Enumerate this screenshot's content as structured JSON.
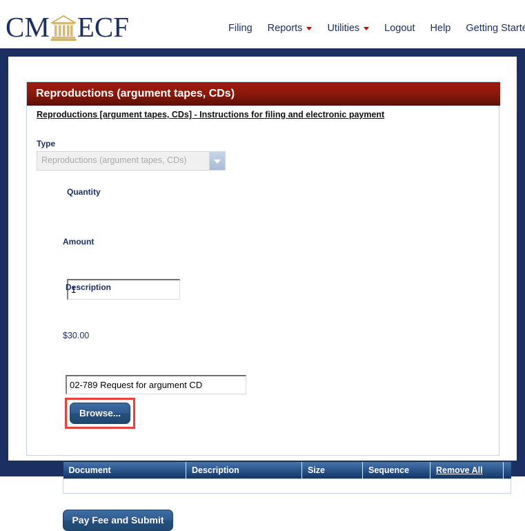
{
  "header": {
    "logo": {
      "left_text": "CM",
      "right_text": "ECF",
      "icon": "courthouse-icon"
    },
    "nav": [
      {
        "label": "Filing",
        "has_dropdown": false
      },
      {
        "label": "Reports",
        "has_dropdown": true
      },
      {
        "label": "Utilities",
        "has_dropdown": true
      },
      {
        "label": "Logout",
        "has_dropdown": false
      },
      {
        "label": "Help",
        "has_dropdown": false
      },
      {
        "label": "Getting Started",
        "has_dropdown": false
      }
    ]
  },
  "card": {
    "title": "Reproductions (argument tapes, CDs)",
    "instructions_link": "Reproductions [argument tapes, CDs] - Instructions for filing and electronic payment",
    "fields": {
      "type": {
        "label": "Type",
        "value": "Reproductions (argument tapes, CDs)",
        "caret_icon": "chevron-down-icon",
        "disabled": true
      },
      "quantity": {
        "label": "Quantity",
        "value": "1"
      },
      "amount": {
        "label": "Amount",
        "value": "$30.00"
      },
      "description": {
        "label": "Description",
        "value": "02-789 Request for argument CD"
      }
    },
    "browse_button": "Browse...",
    "submit_button": "Pay Fee and Submit",
    "table": {
      "columns": [
        "Document",
        "Description",
        "Size",
        "Sequence",
        "Remove All"
      ],
      "rows": []
    }
  },
  "colors": {
    "navy_frame": "#1b2f63",
    "title_bar_red": "#8d1a0b",
    "button_blue": "#2f5c92",
    "table_header_blue": "#2f5b93",
    "highlight_red": "#e8403a",
    "nav_text": "#1b2f63",
    "caret_red": "#cc0000",
    "logo_gold": "#d8bb72"
  }
}
